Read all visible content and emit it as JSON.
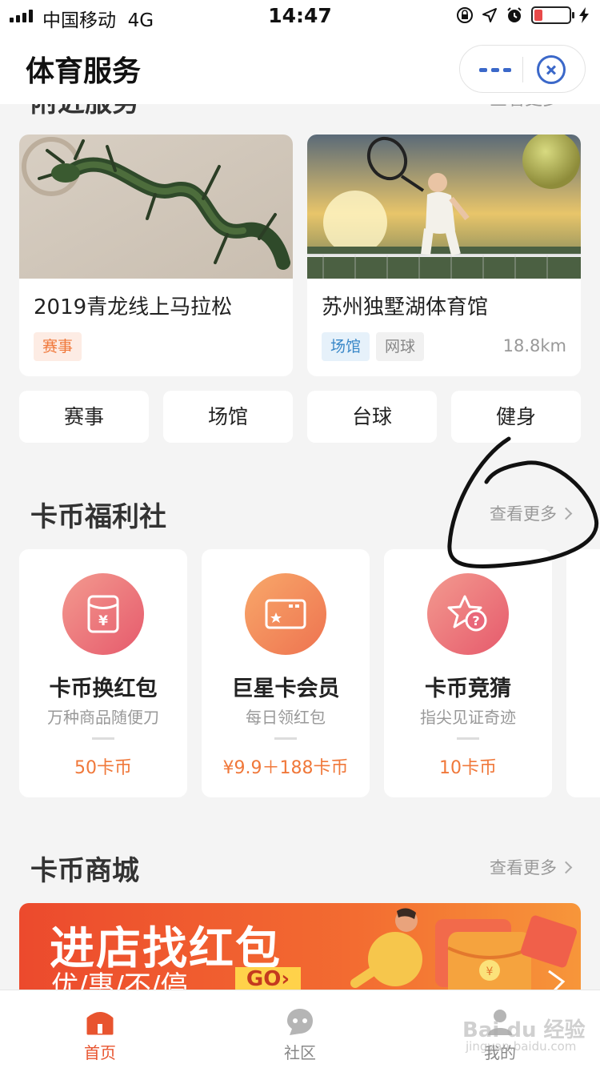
{
  "status_bar": {
    "carrier": "中国移动",
    "network": "4G",
    "time": "14:47"
  },
  "nav": {
    "title": "体育服务"
  },
  "nearby": {
    "heading_partial": "附近服务",
    "more_partial": "查看更多"
  },
  "venues": [
    {
      "name": "2019青龙线上马拉松",
      "tags": [
        {
          "label": "赛事",
          "color": "#f0783a",
          "bg": "#fdece4"
        }
      ],
      "distance": ""
    },
    {
      "name": "苏州独墅湖体育馆",
      "tags": [
        {
          "label": "场馆",
          "color": "#3a88c8",
          "bg": "#e6f1fa"
        },
        {
          "label": "网球",
          "color": "#888888",
          "bg": "#f1f1f1"
        }
      ],
      "distance": "18.8km"
    }
  ],
  "categories": [
    "赛事",
    "场馆",
    "台球",
    "健身"
  ],
  "welfare": {
    "title": "卡币福利社",
    "more": "查看更多",
    "items": [
      {
        "title": "卡币换红包",
        "subtitle": "万种商品随便刀",
        "price": "50卡币",
        "icon": "red-packet-icon",
        "gradient": [
          "#f18c86",
          "#e85c6e"
        ]
      },
      {
        "title": "巨星卡会员",
        "subtitle": "每日领红包",
        "price": "¥9.9＋188卡币",
        "icon": "card-icon",
        "gradient": [
          "#f7a064",
          "#ef7650"
        ]
      },
      {
        "title": "卡币竞猜",
        "subtitle": "指尖见证奇迹",
        "price": "10卡币",
        "icon": "star-question-icon",
        "gradient": [
          "#f18c86",
          "#e85c6e"
        ]
      }
    ]
  },
  "mall": {
    "title": "卡币商城",
    "more": "查看更多",
    "banner": {
      "title": "进店找红包",
      "subtitle": "优/惠/不/停",
      "go": "GO›"
    }
  },
  "tabbar": [
    {
      "label": "首页",
      "icon": "home-icon",
      "active": true
    },
    {
      "label": "社区",
      "icon": "community-icon",
      "active": false
    },
    {
      "label": "我的",
      "icon": "profile-icon",
      "active": false
    }
  ],
  "watermark": {
    "brand": "Bai du 经验",
    "url": "jingyan.baidu.com"
  },
  "colors": {
    "accent": "#f0783a",
    "active_tab": "#e8542f",
    "inactive_tab": "#888888"
  }
}
